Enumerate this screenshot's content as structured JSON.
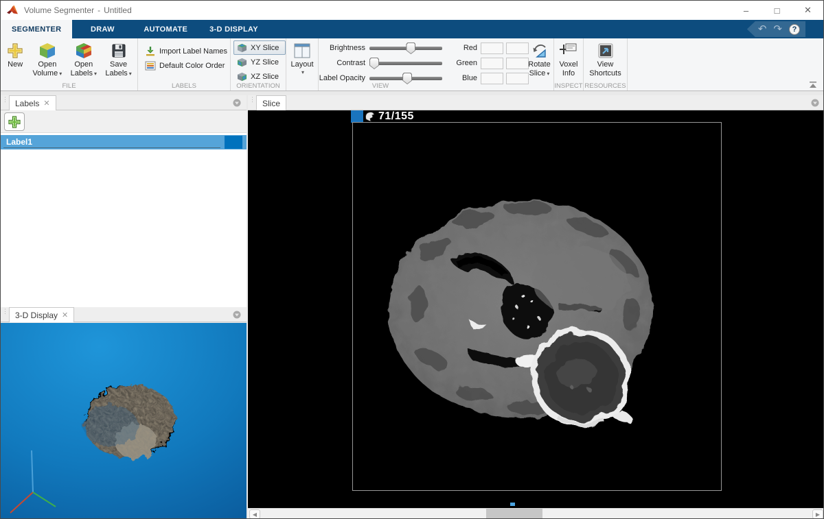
{
  "titlebar": {
    "app": "Volume Segmenter",
    "sep": "-",
    "doc": "Untitled"
  },
  "window_controls": {
    "minimize": "–",
    "maximize": "□",
    "close": "✕"
  },
  "tabs": {
    "segmenter": "SEGMENTER",
    "draw": "DRAW",
    "automate": "AUTOMATE",
    "display3d": "3-D DISPLAY"
  },
  "quick_access": {
    "undo": "↶",
    "redo": "↷",
    "help": "?"
  },
  "ribbon": {
    "file": {
      "caption": "FILE",
      "new": "New",
      "open_volume": [
        "Open",
        "Volume"
      ],
      "open_labels": [
        "Open",
        "Labels"
      ],
      "save_labels": [
        "Save",
        "Labels"
      ]
    },
    "labels": {
      "caption": "LABELS",
      "import_label_names": "Import Label Names",
      "default_color_order": "Default Color Order"
    },
    "orientation": {
      "caption": "ORIENTATION",
      "xy": "XY Slice",
      "yz": "YZ Slice",
      "xz": "XZ Slice"
    },
    "layout": {
      "label": "Layout"
    },
    "view": {
      "caption": "VIEW",
      "brightness": "Brightness",
      "contrast": "Contrast",
      "label_opacity": "Label Opacity",
      "red": "Red",
      "green": "Green",
      "blue": "Blue",
      "rotate_slice": [
        "Rotate",
        "Slice"
      ]
    },
    "inspect": {
      "caption": "INSPECT",
      "voxel_info": [
        "Voxel",
        "Info"
      ]
    },
    "resources": {
      "caption": "RESOURCES",
      "view_shortcuts": [
        "View",
        "Shortcuts"
      ]
    }
  },
  "panels": {
    "labels": {
      "tab": "Labels",
      "close": "✕",
      "rows": [
        {
          "name": "Label1",
          "color": "#0072bd"
        }
      ]
    },
    "display3d": {
      "tab": "3-D Display",
      "close": "✕"
    },
    "slice": {
      "tab": "Slice",
      "slice_indicator": "71/155"
    }
  },
  "state": {
    "sliders": {
      "brightness": 57,
      "contrast": 0,
      "label_opacity": 52
    },
    "hscroll": {
      "left": 41.3,
      "width": 9.8
    },
    "selected_orientation": "XY Slice",
    "selected_tab": "SEGMENTER"
  },
  "colors": {
    "accent": "#0072bd",
    "tabbar": "#0d4c7e",
    "selection": "#55a4d9",
    "viewport3d_light": "#1f95d9",
    "viewport3d_dark": "#0a5a9b"
  }
}
